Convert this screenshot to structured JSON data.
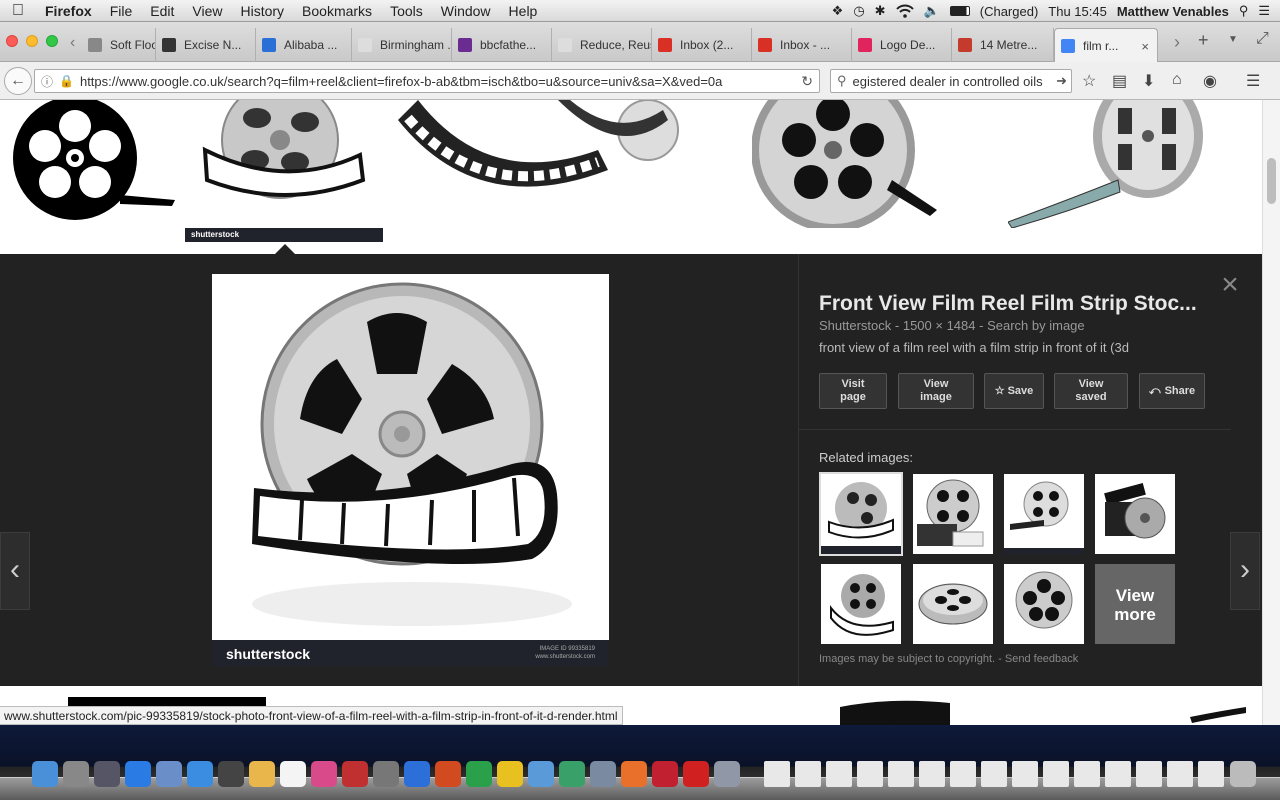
{
  "menubar": {
    "app": "Firefox",
    "items": [
      "File",
      "Edit",
      "View",
      "History",
      "Bookmarks",
      "Tools",
      "Window",
      "Help"
    ],
    "battery": "(Charged)",
    "clock": "Thu 15:45",
    "user": "Matthew Venables"
  },
  "tabs": [
    {
      "label": "Soft Floo...",
      "color": "#888"
    },
    {
      "label": "Excise N...",
      "color": "#333"
    },
    {
      "label": "Alibaba ...",
      "color": "#2a6fd6"
    },
    {
      "label": "Birmingham ...",
      "color": "#ddd"
    },
    {
      "label": "bbcfathe...",
      "color": "#6a2c91"
    },
    {
      "label": "Reduce, Reus...",
      "color": "#ddd"
    },
    {
      "label": "Inbox (2...",
      "color": "#d93025"
    },
    {
      "label": "Inbox - ...",
      "color": "#d93025"
    },
    {
      "label": "Logo De...",
      "color": "#e0245e"
    },
    {
      "label": "14 Metre...",
      "color": "#c43b2d"
    },
    {
      "label": "film r...",
      "color": "#4285f4"
    }
  ],
  "url": "https://www.google.co.uk/search?q=film+reel&client=firefox-b-ab&tbm=isch&tbo=u&source=univ&sa=X&ved=0a",
  "search_value": "egistered dealer in controlled oils",
  "thumb_caption": "shutterstock",
  "panel": {
    "title": "Front View Film Reel Film Strip Stoc...",
    "source": "Shutterstock",
    "dimensions": "1500 × 1484",
    "search_by_image": "Search by image",
    "description": "front view of a film reel with a film strip in front of it (3d",
    "buttons": {
      "visit": "Visit page",
      "view": "View image",
      "save": "Save",
      "saved": "View saved",
      "share": "Share"
    },
    "related_label": "Related images:",
    "view_more": "View more",
    "copyright": "Images may be subject to copyright.",
    "feedback": "Send feedback",
    "watermark": "shutterstock",
    "image_id_label": "IMAGE ID",
    "image_id": "99335819",
    "site": "www.shutterstock.com"
  },
  "status_url": "www.shutterstock.com/pic-99335819/stock-photo-front-view-of-a-film-reel-with-a-film-strip-in-front-of-it-d-render.html",
  "icons": [
    "apple-icon",
    "dropbox-icon",
    "time-machine-icon",
    "bluetooth-icon",
    "wifi-icon",
    "volume-icon",
    "battery-icon",
    "spotlight-icon",
    "list-icon",
    "back-icon",
    "info-icon",
    "lock-icon",
    "reload-icon",
    "search-icon",
    "bookmark-star-icon",
    "reading-list-icon",
    "download-icon",
    "home-icon",
    "pocket-icon",
    "menu-icon",
    "close-icon",
    "prev-arrow-icon",
    "next-arrow-icon",
    "star-icon",
    "share-icon"
  ]
}
